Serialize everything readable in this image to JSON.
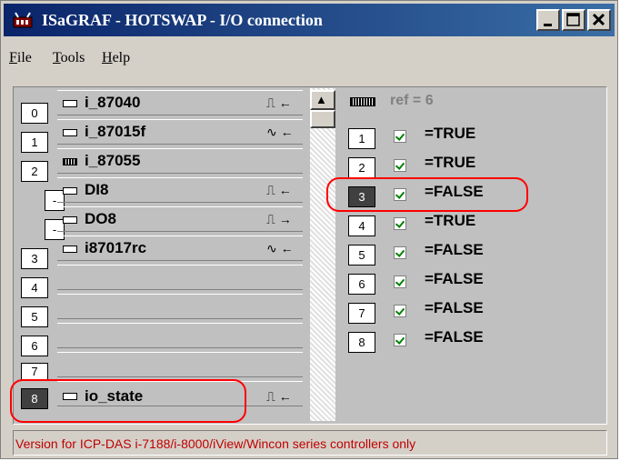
{
  "window": {
    "title": "ISaGRAF - HOTSWAP - I/O connection",
    "minimize_glyph": "_",
    "maximize_glyph": "□",
    "close_glyph": "×"
  },
  "menu": {
    "file": "File",
    "tools": "Tools",
    "help": "Help"
  },
  "slots": [
    {
      "index": "0",
      "name": "i_87040",
      "signal": "⎍ ←",
      "icon": "board-icon"
    },
    {
      "index": "1",
      "name": "i_87015f",
      "signal": "∿ ←",
      "icon": "board-icon"
    },
    {
      "index": "2",
      "name": "i_87055",
      "signal": "",
      "icon": "board-dark-icon"
    },
    {
      "index": "-",
      "name": "DI8",
      "signal": "⎍ ←",
      "icon": "board-icon"
    },
    {
      "index": "-",
      "name": "DO8",
      "signal": "⎍ →",
      "icon": "board-icon"
    },
    {
      "index": "3",
      "name": "i87017rc",
      "signal": "∿ ←",
      "icon": "board-icon"
    },
    {
      "index": "4",
      "name": "",
      "signal": "",
      "icon": ""
    },
    {
      "index": "5",
      "name": "",
      "signal": "",
      "icon": ""
    },
    {
      "index": "6",
      "name": "",
      "signal": "",
      "icon": ""
    },
    {
      "index": "7",
      "name": "",
      "signal": "",
      "icon": ""
    },
    {
      "index": "8",
      "name": "io_state",
      "signal": "⎍ ←",
      "icon": "board-icon"
    }
  ],
  "right_panel": {
    "ref": "ref = 6",
    "channels": [
      {
        "index": "1",
        "value": "=TRUE"
      },
      {
        "index": "2",
        "value": "=TRUE"
      },
      {
        "index": "3",
        "value": "=FALSE"
      },
      {
        "index": "4",
        "value": "=TRUE"
      },
      {
        "index": "5",
        "value": "=FALSE"
      },
      {
        "index": "6",
        "value": "=FALSE"
      },
      {
        "index": "7",
        "value": "=FALSE"
      },
      {
        "index": "8",
        "value": "=FALSE"
      }
    ]
  },
  "scrollbar": {
    "up_glyph": "▲"
  },
  "status": {
    "text": "Version for ICP-DAS i-7188/i-8000/iView/Wincon series controllers only"
  },
  "colors": {
    "title_start": "#0a246a",
    "title_end": "#3a6ea5",
    "highlight": "#ff0000",
    "status_text": "#c00000"
  }
}
